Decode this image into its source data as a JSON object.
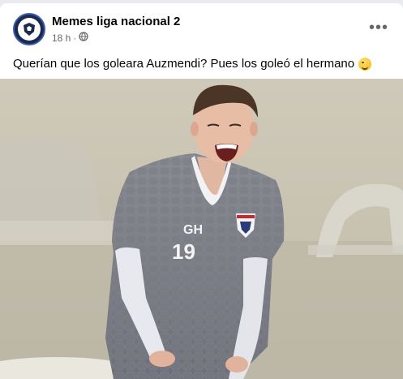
{
  "post": {
    "page_name": "Memes liga nacional 2",
    "time": "18 h",
    "separator": "·",
    "privacy_icon": "globe-icon",
    "more_icon": "more-horizontal-icon",
    "more_label": "•••",
    "text": "Querían que los goleara Auzmendi? Pues los goleó el hermano",
    "emoji": "winking-face-emoji"
  },
  "photo": {
    "jersey_text": "GH",
    "jersey_number": "19"
  },
  "colors": {
    "background": "#e9ebee",
    "card": "#ffffff",
    "name": "#050505",
    "meta": "#65676b",
    "jersey": "#7b7d86"
  }
}
